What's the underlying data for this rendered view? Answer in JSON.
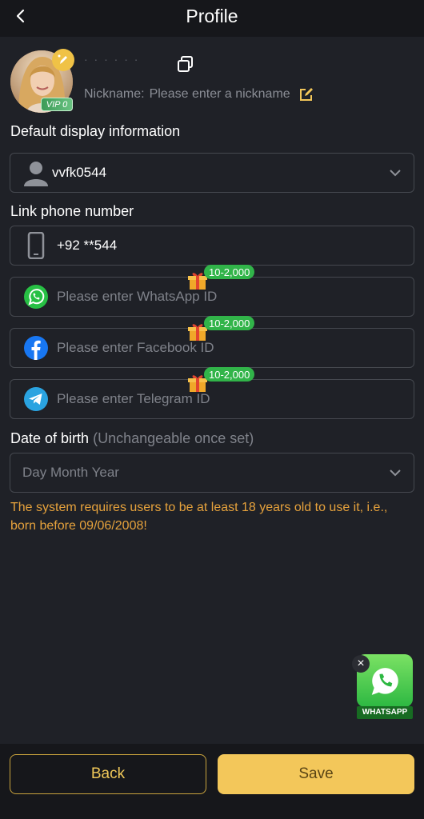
{
  "header": {
    "title": "Profile"
  },
  "profile": {
    "username": "· · · · · ·",
    "vip_label": "VIP 0",
    "nickname_label": "Nickname:",
    "nickname_placeholder": "Please enter a nickname"
  },
  "default_display": {
    "label": "Default display information",
    "value": "vvfk0544"
  },
  "phone": {
    "label": "Link phone number",
    "value": "+92 **544"
  },
  "socials": [
    {
      "placeholder": "Please enter WhatsApp ID",
      "reward": "10-2,000",
      "icon": "whatsapp-icon"
    },
    {
      "placeholder": "Please enter Facebook ID",
      "reward": "10-2,000",
      "icon": "facebook-icon"
    },
    {
      "placeholder": "Please enter Telegram ID",
      "reward": "10-2,000",
      "icon": "telegram-icon"
    }
  ],
  "dob": {
    "label": "Date of birth",
    "note": "(Unchangeable once set)",
    "placeholder": "Day Month Year"
  },
  "warning": "The system requires users to be at least 18 years old to use it, i.e., born before 09/06/2008!",
  "whatsapp_widget": {
    "label": "WHATSAPP",
    "close": "×"
  },
  "buttons": {
    "back": "Back",
    "save": "Save"
  },
  "colors": {
    "background": "#1f2127",
    "accent": "#f3c75a",
    "warning": "#e6a23c",
    "reward_badge": "#31b449"
  }
}
